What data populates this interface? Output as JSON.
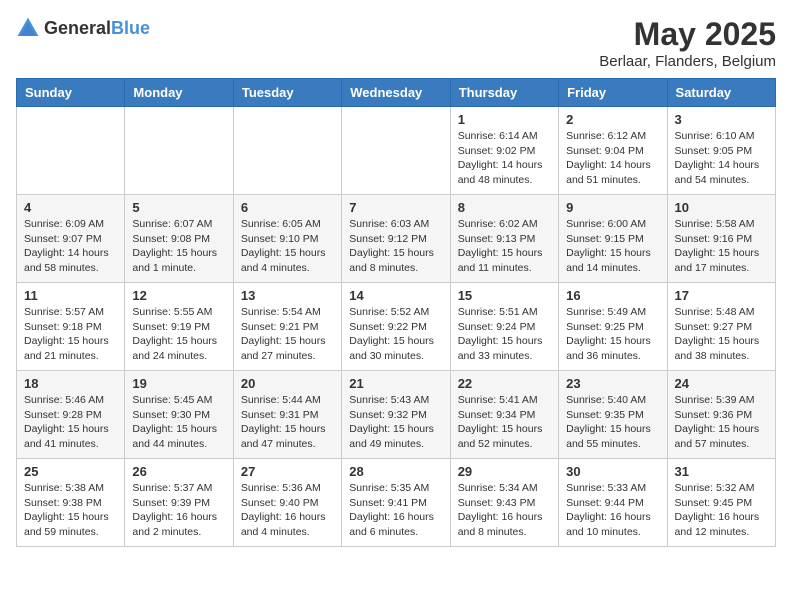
{
  "logo": {
    "general": "General",
    "blue": "Blue"
  },
  "header": {
    "month": "May 2025",
    "location": "Berlaar, Flanders, Belgium"
  },
  "weekdays": [
    "Sunday",
    "Monday",
    "Tuesday",
    "Wednesday",
    "Thursday",
    "Friday",
    "Saturday"
  ],
  "weeks": [
    [
      {
        "day": "",
        "info": ""
      },
      {
        "day": "",
        "info": ""
      },
      {
        "day": "",
        "info": ""
      },
      {
        "day": "",
        "info": ""
      },
      {
        "day": "1",
        "info": "Sunrise: 6:14 AM\nSunset: 9:02 PM\nDaylight: 14 hours\nand 48 minutes."
      },
      {
        "day": "2",
        "info": "Sunrise: 6:12 AM\nSunset: 9:04 PM\nDaylight: 14 hours\nand 51 minutes."
      },
      {
        "day": "3",
        "info": "Sunrise: 6:10 AM\nSunset: 9:05 PM\nDaylight: 14 hours\nand 54 minutes."
      }
    ],
    [
      {
        "day": "4",
        "info": "Sunrise: 6:09 AM\nSunset: 9:07 PM\nDaylight: 14 hours\nand 58 minutes."
      },
      {
        "day": "5",
        "info": "Sunrise: 6:07 AM\nSunset: 9:08 PM\nDaylight: 15 hours\nand 1 minute."
      },
      {
        "day": "6",
        "info": "Sunrise: 6:05 AM\nSunset: 9:10 PM\nDaylight: 15 hours\nand 4 minutes."
      },
      {
        "day": "7",
        "info": "Sunrise: 6:03 AM\nSunset: 9:12 PM\nDaylight: 15 hours\nand 8 minutes."
      },
      {
        "day": "8",
        "info": "Sunrise: 6:02 AM\nSunset: 9:13 PM\nDaylight: 15 hours\nand 11 minutes."
      },
      {
        "day": "9",
        "info": "Sunrise: 6:00 AM\nSunset: 9:15 PM\nDaylight: 15 hours\nand 14 minutes."
      },
      {
        "day": "10",
        "info": "Sunrise: 5:58 AM\nSunset: 9:16 PM\nDaylight: 15 hours\nand 17 minutes."
      }
    ],
    [
      {
        "day": "11",
        "info": "Sunrise: 5:57 AM\nSunset: 9:18 PM\nDaylight: 15 hours\nand 21 minutes."
      },
      {
        "day": "12",
        "info": "Sunrise: 5:55 AM\nSunset: 9:19 PM\nDaylight: 15 hours\nand 24 minutes."
      },
      {
        "day": "13",
        "info": "Sunrise: 5:54 AM\nSunset: 9:21 PM\nDaylight: 15 hours\nand 27 minutes."
      },
      {
        "day": "14",
        "info": "Sunrise: 5:52 AM\nSunset: 9:22 PM\nDaylight: 15 hours\nand 30 minutes."
      },
      {
        "day": "15",
        "info": "Sunrise: 5:51 AM\nSunset: 9:24 PM\nDaylight: 15 hours\nand 33 minutes."
      },
      {
        "day": "16",
        "info": "Sunrise: 5:49 AM\nSunset: 9:25 PM\nDaylight: 15 hours\nand 36 minutes."
      },
      {
        "day": "17",
        "info": "Sunrise: 5:48 AM\nSunset: 9:27 PM\nDaylight: 15 hours\nand 38 minutes."
      }
    ],
    [
      {
        "day": "18",
        "info": "Sunrise: 5:46 AM\nSunset: 9:28 PM\nDaylight: 15 hours\nand 41 minutes."
      },
      {
        "day": "19",
        "info": "Sunrise: 5:45 AM\nSunset: 9:30 PM\nDaylight: 15 hours\nand 44 minutes."
      },
      {
        "day": "20",
        "info": "Sunrise: 5:44 AM\nSunset: 9:31 PM\nDaylight: 15 hours\nand 47 minutes."
      },
      {
        "day": "21",
        "info": "Sunrise: 5:43 AM\nSunset: 9:32 PM\nDaylight: 15 hours\nand 49 minutes."
      },
      {
        "day": "22",
        "info": "Sunrise: 5:41 AM\nSunset: 9:34 PM\nDaylight: 15 hours\nand 52 minutes."
      },
      {
        "day": "23",
        "info": "Sunrise: 5:40 AM\nSunset: 9:35 PM\nDaylight: 15 hours\nand 55 minutes."
      },
      {
        "day": "24",
        "info": "Sunrise: 5:39 AM\nSunset: 9:36 PM\nDaylight: 15 hours\nand 57 minutes."
      }
    ],
    [
      {
        "day": "25",
        "info": "Sunrise: 5:38 AM\nSunset: 9:38 PM\nDaylight: 15 hours\nand 59 minutes."
      },
      {
        "day": "26",
        "info": "Sunrise: 5:37 AM\nSunset: 9:39 PM\nDaylight: 16 hours\nand 2 minutes."
      },
      {
        "day": "27",
        "info": "Sunrise: 5:36 AM\nSunset: 9:40 PM\nDaylight: 16 hours\nand 4 minutes."
      },
      {
        "day": "28",
        "info": "Sunrise: 5:35 AM\nSunset: 9:41 PM\nDaylight: 16 hours\nand 6 minutes."
      },
      {
        "day": "29",
        "info": "Sunrise: 5:34 AM\nSunset: 9:43 PM\nDaylight: 16 hours\nand 8 minutes."
      },
      {
        "day": "30",
        "info": "Sunrise: 5:33 AM\nSunset: 9:44 PM\nDaylight: 16 hours\nand 10 minutes."
      },
      {
        "day": "31",
        "info": "Sunrise: 5:32 AM\nSunset: 9:45 PM\nDaylight: 16 hours\nand 12 minutes."
      }
    ]
  ]
}
